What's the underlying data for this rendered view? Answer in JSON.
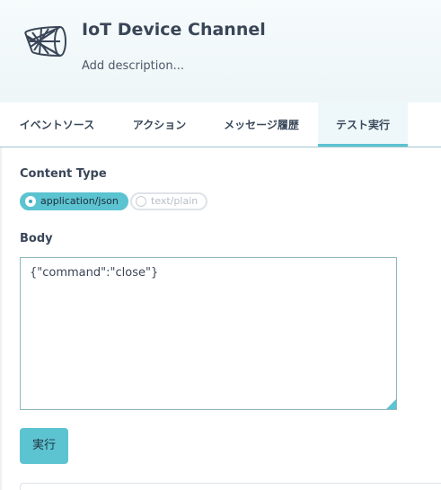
{
  "header": {
    "title": "IoT Device Channel",
    "description_placeholder": "Add description...",
    "logo_icon": "basketball-net-icon"
  },
  "tabs": [
    {
      "label": "イベントソース",
      "active": false
    },
    {
      "label": "アクション",
      "active": false
    },
    {
      "label": "メッセージ履歴",
      "active": false
    },
    {
      "label": "テスト実行",
      "active": true
    }
  ],
  "content_type": {
    "label": "Content Type",
    "options": [
      {
        "label": "application/json",
        "selected": true
      },
      {
        "label": "text/plain",
        "selected": false
      }
    ]
  },
  "body": {
    "label": "Body",
    "value": "{\"command\":\"close\"}"
  },
  "run_button": {
    "label": "実行"
  },
  "colors": {
    "accent": "#5cc3d1",
    "text": "#3a4658",
    "header_bg": "#eef6f8"
  }
}
